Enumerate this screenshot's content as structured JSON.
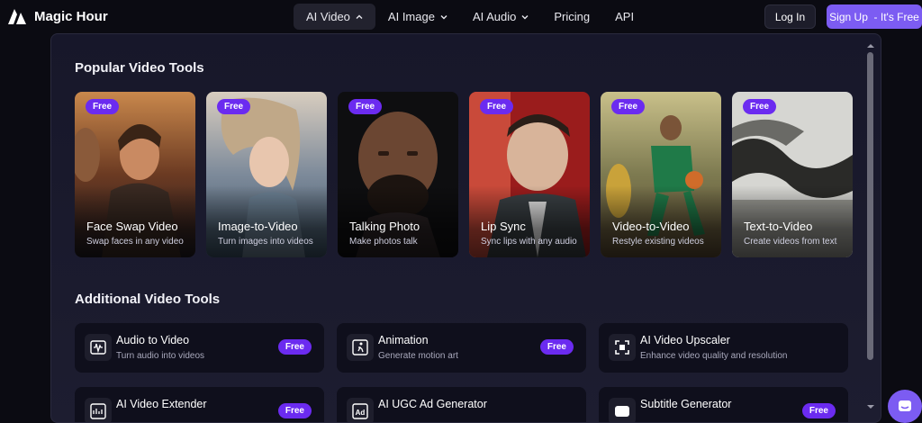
{
  "brand": {
    "name": "Magic Hour"
  },
  "nav": {
    "items": [
      {
        "label": "AI Video",
        "has_chevron": true,
        "chevron": "up",
        "active": true
      },
      {
        "label": "AI Image",
        "has_chevron": true,
        "chevron": "down",
        "active": false
      },
      {
        "label": "AI Audio",
        "has_chevron": true,
        "chevron": "down",
        "active": false
      },
      {
        "label": "Pricing",
        "has_chevron": false,
        "active": false
      },
      {
        "label": "API",
        "has_chevron": false,
        "active": false
      }
    ],
    "login_label": "Log In",
    "signup_label": "Sign Up  - It's Free"
  },
  "popular": {
    "heading": "Popular Video Tools",
    "tools": [
      {
        "title": "Face Swap Video",
        "subtitle": "Swap faces in any video",
        "badge": "Free"
      },
      {
        "title": "Image-to-Video",
        "subtitle": "Turn images into videos",
        "badge": "Free"
      },
      {
        "title": "Talking Photo",
        "subtitle": "Make photos talk",
        "badge": "Free"
      },
      {
        "title": "Lip Sync",
        "subtitle": "Sync lips with any audio",
        "badge": "Free"
      },
      {
        "title": "Video-to-Video",
        "subtitle": "Restyle existing videos",
        "badge": "Free"
      },
      {
        "title": "Text-to-Video",
        "subtitle": "Create videos from text",
        "badge": "Free"
      }
    ]
  },
  "additional": {
    "heading": "Additional Video Tools",
    "tools": [
      {
        "name": "Audio to Video",
        "desc": "Turn audio into videos",
        "badge": "Free",
        "icon": "waveform-icon"
      },
      {
        "name": "Animation",
        "desc": "Generate motion art",
        "badge": "Free",
        "icon": "running-figure-icon"
      },
      {
        "name": "AI Video Upscaler",
        "desc": "Enhance video quality and resolution",
        "badge": "",
        "icon": "expand-icon"
      },
      {
        "name": "AI Video Extender",
        "desc": "",
        "badge": "Free",
        "icon": "video-extend-icon"
      },
      {
        "name": "AI UGC Ad Generator",
        "desc": "",
        "badge": "",
        "icon": "ad-icon"
      },
      {
        "name": "Subtitle Generator",
        "desc": "",
        "badge": "Free",
        "icon": "subtitle-icon"
      }
    ]
  },
  "colors": {
    "accent": "#7c5cf2",
    "badge": "#6b2bf0",
    "panel": "#17172a",
    "page": "#0b0b12"
  }
}
